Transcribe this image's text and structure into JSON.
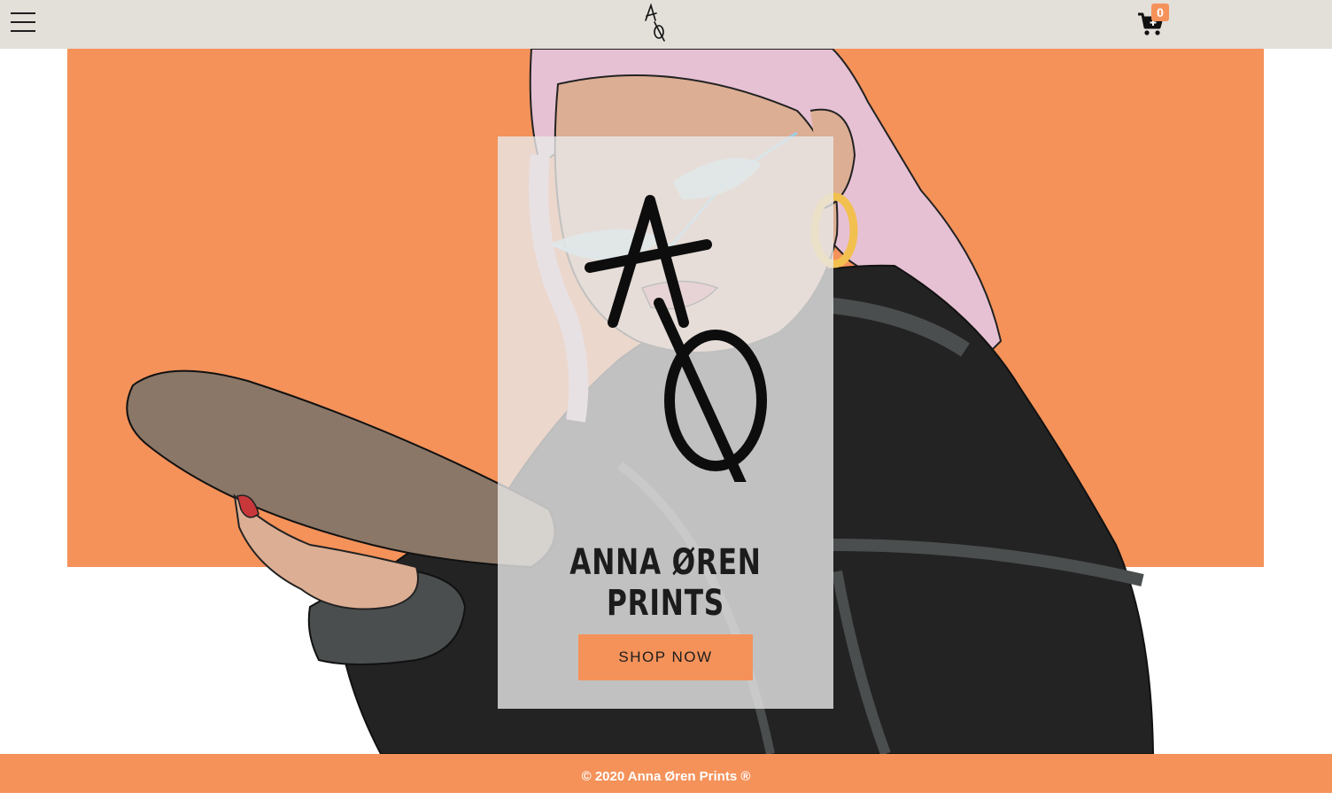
{
  "header": {
    "menu_icon": "hamburger-menu-icon",
    "logo_icon": "ao-monogram-logo",
    "cart_icon": "shopping-cart-icon",
    "cart_count": "0"
  },
  "hero": {
    "brand_title": "ANNA ØREN PRINTS",
    "cta_label": "SHOP NOW",
    "colors": {
      "accent": "#f4925a",
      "header_bg": "#e3dfd9",
      "text_dark": "#1c1c1c"
    }
  },
  "footer": {
    "copyright": "© 2020 Anna Øren Prints ®"
  }
}
